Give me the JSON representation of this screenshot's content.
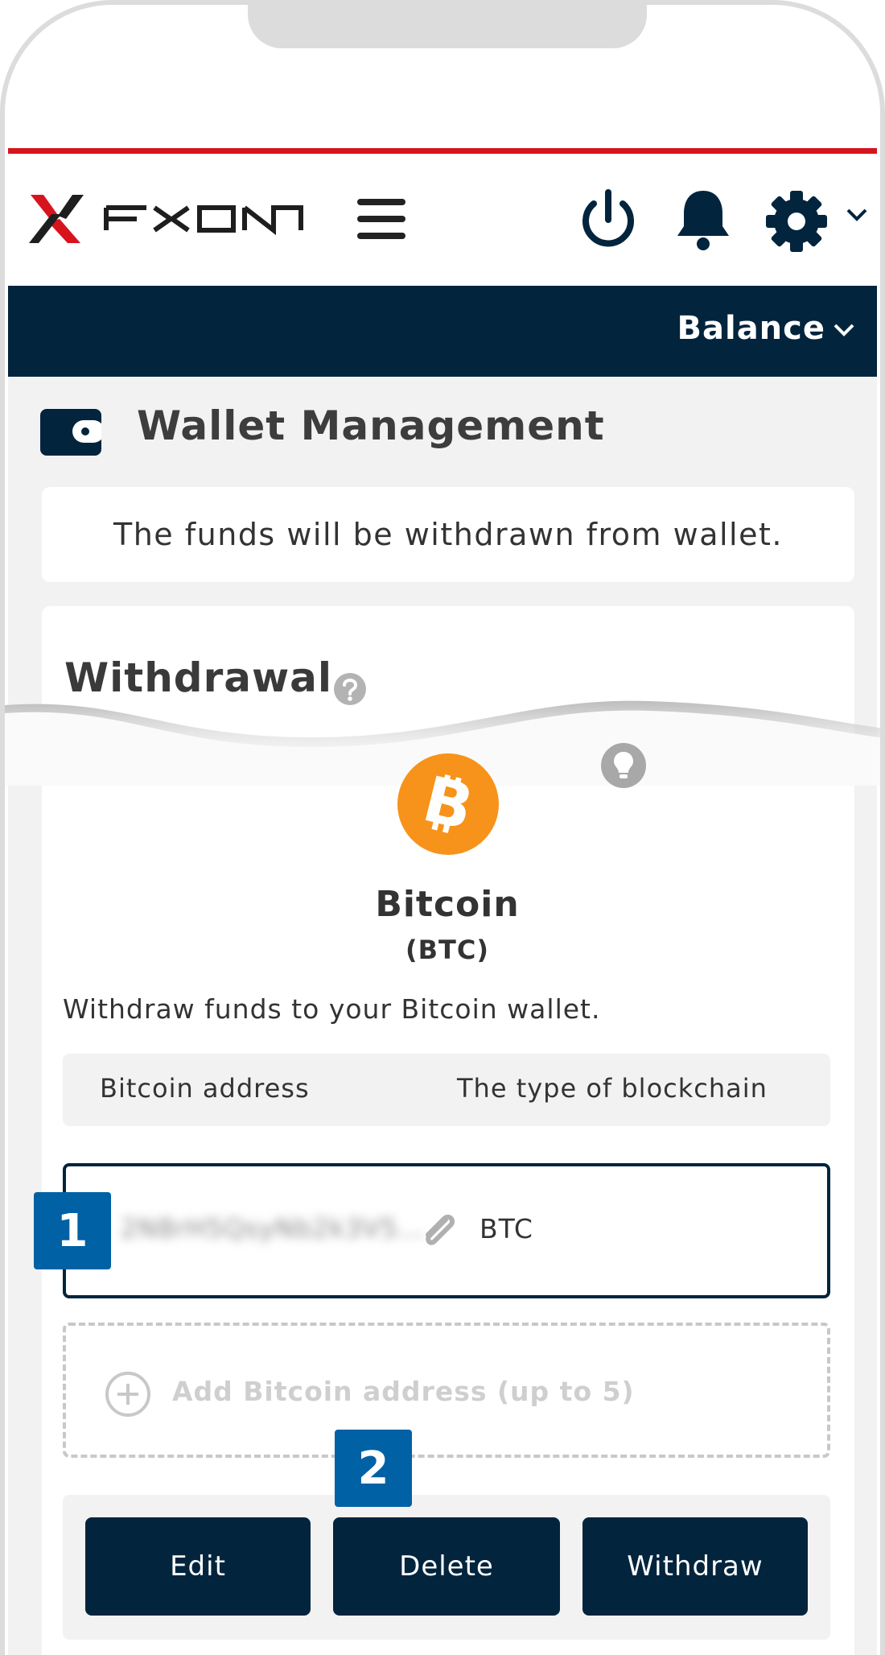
{
  "header": {
    "logo_text": "FXON",
    "icons": [
      "menu-icon",
      "power-icon",
      "bell-icon",
      "gear-icon",
      "chevron-down-icon"
    ]
  },
  "navbar": {
    "balance_label": "Balance"
  },
  "page": {
    "title": "Wallet Management",
    "notice": "The funds will be withdrawn from wallet."
  },
  "withdrawal": {
    "title": "Withdrawal",
    "coin": {
      "name": "Bitcoin",
      "code": "(BTC)"
    },
    "description": "Withdraw funds to your Bitcoin wallet.",
    "table_headers": [
      "Bitcoin address",
      "The type of blockchain"
    ],
    "rows": [
      {
        "address": "2N8rH5QsyNb2k3V5...",
        "chain": "BTC"
      }
    ],
    "add_label": "Add Bitcoin address (up to 5)",
    "buttons": {
      "edit": "Edit",
      "delete": "Delete",
      "withdraw": "Withdraw"
    }
  },
  "annotations": {
    "badge1": "1",
    "badge2": "2"
  },
  "colors": {
    "navy": "#02243d",
    "brand_red": "#d7141e",
    "bitcoin_orange": "#f7931a",
    "badge_blue": "#0061a5"
  }
}
